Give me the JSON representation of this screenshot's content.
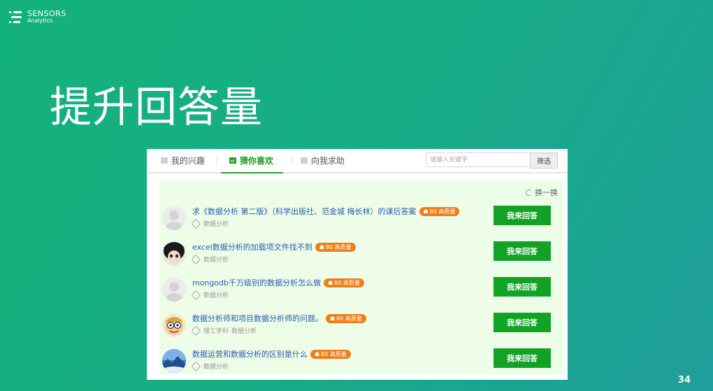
{
  "brand": {
    "name": "SENSORS",
    "sub": "Analytics"
  },
  "slide": {
    "title": "提升回答量",
    "page_number": "34"
  },
  "tabs": [
    {
      "label": "我的兴趣",
      "icon": "list-icon",
      "active": false
    },
    {
      "label": "猜你喜欢",
      "icon": "check-icon",
      "active": true
    },
    {
      "label": "向我求助",
      "icon": "help-icon",
      "active": false
    }
  ],
  "search": {
    "placeholder": "请输入关键字"
  },
  "filter_label": "筛选",
  "refresh_label": "换一换",
  "badge_label": "80 高质量",
  "answer_label": "我来回答",
  "questions": [
    {
      "title": "求《数据分析 第二版》（科学出版社、范金城 梅长林）的课后答案",
      "tags": [
        "数据分析"
      ],
      "avatar": "default-avatar"
    },
    {
      "title": "excel数据分析的加载项文件找不到",
      "tags": [
        "数据分析"
      ],
      "avatar": "photo-avatar"
    },
    {
      "title": "mongodb千万级别的数据分析怎么做",
      "tags": [
        "数据分析"
      ],
      "avatar": "default-avatar"
    },
    {
      "title": "数据分析师和项目数据分析师的问题。",
      "tags": [
        "理工学科",
        "数据分析"
      ],
      "avatar": "cartoon-avatar"
    },
    {
      "title": "数据运营和数据分析的区别是什么",
      "tags": [
        "数据分析"
      ],
      "avatar": "landscape-avatar"
    }
  ]
}
